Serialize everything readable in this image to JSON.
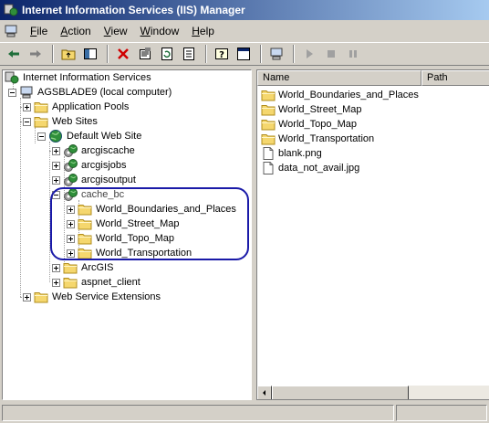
{
  "window": {
    "title": "Internet Information Services (IIS) Manager"
  },
  "menu": [
    {
      "label": "File",
      "key": "F",
      "rest": "ile"
    },
    {
      "label": "Action",
      "key": "A",
      "rest": "ction"
    },
    {
      "label": "View",
      "key": "V",
      "rest": "iew"
    },
    {
      "label": "Window",
      "key": "W",
      "rest": "indow"
    },
    {
      "label": "Help",
      "key": "H",
      "rest": "elp"
    }
  ],
  "toolbar": {
    "buttons": [
      "back-icon",
      "forward-icon",
      "up-folder-icon",
      "show-hide-tree-icon",
      "delete-icon",
      "properties-icon",
      "refresh-icon",
      "export-list-icon",
      "help-icon",
      "console-icon",
      "computer-icon",
      "play-icon",
      "stop-icon",
      "pause-icon"
    ]
  },
  "tree": {
    "root": "Internet Information Services",
    "computer": "AGSBLADE9 (local computer)",
    "app_pools": "Application Pools",
    "web_sites": "Web Sites",
    "default_site": "Default Web Site",
    "arcgiscache": "arcgiscache",
    "arcgisjobs": "arcgisjobs",
    "arcgisoutput": "arcgisoutput",
    "cache_bc": "cache_bc",
    "cache_children": [
      "World_Boundaries_and_Places",
      "World_Street_Map",
      "World_Topo_Map",
      "World_Transportation"
    ],
    "arcgis": "ArcGIS",
    "aspnet_client": "aspnet_client",
    "web_service_extensions": "Web Service Extensions"
  },
  "list": {
    "columns": [
      "Name",
      "Path"
    ],
    "items": [
      {
        "name": "World_Boundaries_and_Places",
        "type": "folder"
      },
      {
        "name": "World_Street_Map",
        "type": "folder"
      },
      {
        "name": "World_Topo_Map",
        "type": "folder"
      },
      {
        "name": "World_Transportation",
        "type": "folder"
      },
      {
        "name": "blank.png",
        "type": "file"
      },
      {
        "name": "data_not_avail.jpg",
        "type": "file"
      }
    ]
  },
  "colors": {
    "titlebar": "#0a246a",
    "highlight_outline": "#1a1aa8",
    "folder": "#f5d76e"
  }
}
